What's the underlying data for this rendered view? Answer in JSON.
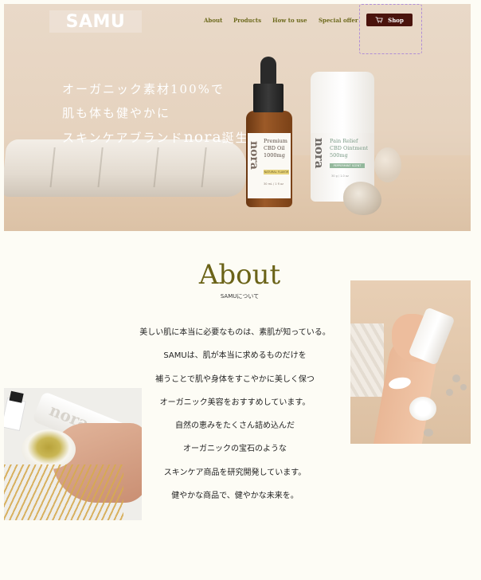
{
  "brand": {
    "logo": "SAMU"
  },
  "nav": {
    "items": [
      "About",
      "Products",
      "How to use",
      "Special offer"
    ],
    "shop_label": "Shop"
  },
  "hero": {
    "lines": [
      "オーガニック素材100%で",
      "肌も体も健やかに",
      "スキンケアブランド",
      "nora",
      "誕生"
    ],
    "products": {
      "oil": {
        "brand": "nora",
        "name_lines": [
          "Premium",
          "CBD Oil",
          "1000mg"
        ],
        "flavor": "NATURAL FLAVOR",
        "volume": "30 mL / 1 fl oz"
      },
      "ointment": {
        "brand": "nora",
        "name_lines": [
          "Pain Relief",
          "CBD Ointment",
          "500mg"
        ],
        "scent": "PEPPERMINT SCENT",
        "volume": "30 g / 1.0 oz"
      }
    }
  },
  "about": {
    "title": "About",
    "subtitle": "SAMUについて",
    "body": [
      "美しい肌に本当に必要なものは、素肌が知っている。",
      "SAMUは、肌が本当に求めるものだけを",
      "補うことで肌や身体をすこやかに美しく保つ",
      "オーガニック美容をおすすめしています。",
      "自然の恵みをたくさん詰め込んだ",
      "オーガニックの宝石のような",
      "スキンケア商品を研究開発しています。",
      "健やかな商品で、健やかな未来を。"
    ],
    "left_photo": {
      "tube_text": "nora"
    }
  },
  "colors": {
    "background": "#fdfcf5",
    "accent_olive": "#6b6318",
    "shop_button": "#4a130c",
    "nav_text": "#6d6a1d"
  },
  "icons": {
    "cart": "cart-icon"
  }
}
